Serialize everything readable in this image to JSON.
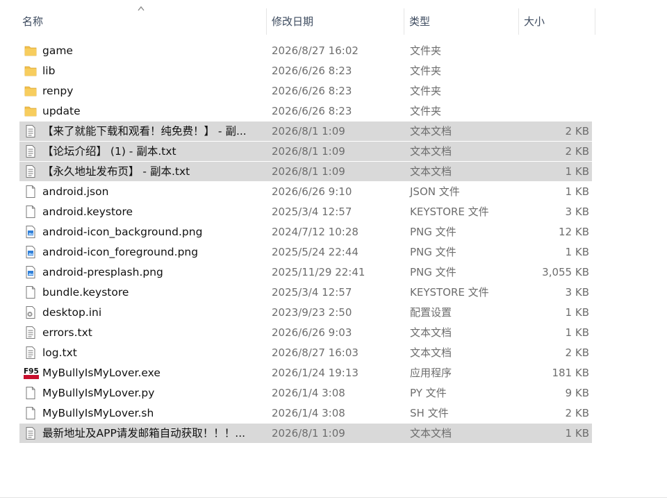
{
  "columns": {
    "name": "名称",
    "date": "修改日期",
    "type": "类型",
    "size": "大小"
  },
  "files": [
    {
      "name": "game",
      "date": "2026/8/27 16:02",
      "type": "文件夹",
      "size": "",
      "icon": "folder-icon",
      "selected": false
    },
    {
      "name": "lib",
      "date": "2026/6/26 8:23",
      "type": "文件夹",
      "size": "",
      "icon": "folder-icon",
      "selected": false
    },
    {
      "name": "renpy",
      "date": "2026/6/26 8:23",
      "type": "文件夹",
      "size": "",
      "icon": "folder-icon",
      "selected": false
    },
    {
      "name": "update",
      "date": "2026/6/26 8:23",
      "type": "文件夹",
      "size": "",
      "icon": "folder-icon",
      "selected": false
    },
    {
      "name": "【来了就能下载和观看！纯免费！】 - 副...",
      "date": "2026/8/1 1:09",
      "type": "文本文档",
      "size": "2 KB",
      "icon": "text-file-icon",
      "selected": true
    },
    {
      "name": "【论坛介绍】 (1) - 副本.txt",
      "date": "2026/8/1 1:09",
      "type": "文本文档",
      "size": "2 KB",
      "icon": "text-file-icon",
      "selected": true
    },
    {
      "name": "【永久地址发布页】 - 副本.txt",
      "date": "2026/8/1 1:09",
      "type": "文本文档",
      "size": "1 KB",
      "icon": "text-file-icon",
      "selected": true
    },
    {
      "name": "android.json",
      "date": "2026/6/26 9:10",
      "type": "JSON 文件",
      "size": "1 KB",
      "icon": "blank-file-icon",
      "selected": false
    },
    {
      "name": "android.keystore",
      "date": "2025/3/4 12:57",
      "type": "KEYSTORE 文件",
      "size": "3 KB",
      "icon": "blank-file-icon",
      "selected": false
    },
    {
      "name": "android-icon_background.png",
      "date": "2024/7/12 10:28",
      "type": "PNG 文件",
      "size": "12 KB",
      "icon": "image-file-icon",
      "selected": false
    },
    {
      "name": "android-icon_foreground.png",
      "date": "2025/5/24 22:44",
      "type": "PNG 文件",
      "size": "1 KB",
      "icon": "image-file-icon",
      "selected": false
    },
    {
      "name": "android-presplash.png",
      "date": "2025/11/29 22:41",
      "type": "PNG 文件",
      "size": "3,055 KB",
      "icon": "image-file-icon",
      "selected": false
    },
    {
      "name": "bundle.keystore",
      "date": "2025/3/4 12:57",
      "type": "KEYSTORE 文件",
      "size": "3 KB",
      "icon": "blank-file-icon",
      "selected": false
    },
    {
      "name": "desktop.ini",
      "date": "2023/9/23 2:50",
      "type": "配置设置",
      "size": "1 KB",
      "icon": "settings-file-icon",
      "selected": false
    },
    {
      "name": "errors.txt",
      "date": "2026/6/26 9:03",
      "type": "文本文档",
      "size": "1 KB",
      "icon": "text-file-icon",
      "selected": false
    },
    {
      "name": "log.txt",
      "date": "2026/8/27 16:03",
      "type": "文本文档",
      "size": "2 KB",
      "icon": "text-file-icon",
      "selected": false
    },
    {
      "name": "MyBullyIsMyLover.exe",
      "date": "2026/1/24 19:13",
      "type": "应用程序",
      "size": "181 KB",
      "icon": "app-exe-icon",
      "selected": false
    },
    {
      "name": "MyBullyIsMyLover.py",
      "date": "2026/1/4 3:08",
      "type": "PY 文件",
      "size": "9 KB",
      "icon": "blank-file-icon",
      "selected": false
    },
    {
      "name": "MyBullyIsMyLover.sh",
      "date": "2026/1/4 3:08",
      "type": "SH 文件",
      "size": "2 KB",
      "icon": "blank-file-icon",
      "selected": false
    },
    {
      "name": "最新地址及APP请发邮箱自动获取！！！...",
      "date": "2026/8/1 1:09",
      "type": "文本文档",
      "size": "1 KB",
      "icon": "text-file-icon",
      "selected": true
    }
  ],
  "colors": {
    "selection": "#d9d9d9",
    "folder": "#f3c14d",
    "image_accent": "#2f7fd8",
    "exe_red": "#c8102e"
  }
}
